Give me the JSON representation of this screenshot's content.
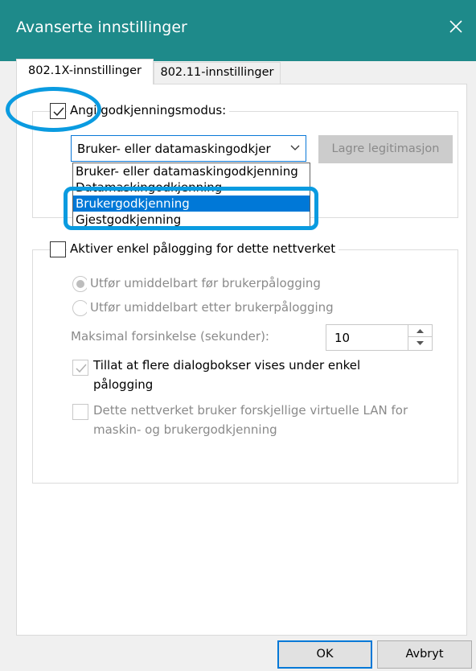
{
  "window": {
    "title": "Avanserte innstillinger",
    "close_icon": "close-icon",
    "titlebar_color": "#1e8a8a"
  },
  "tabs": [
    {
      "label": "802.1X-innstillinger",
      "active": true
    },
    {
      "label": "802.11-innstillinger",
      "active": false
    }
  ],
  "auth_mode": {
    "checkbox_label": "Angi godkjenningsmodus:",
    "checked": true,
    "combo_value": "Bruker- eller datamaskingodkjer",
    "options": [
      "Bruker- eller datamaskingodkjenning",
      "Datamaskingodkjenning",
      "Brukergodkjenning",
      "Gjestgodkjenning"
    ],
    "selected_index": 2,
    "save_button_label": "Lagre legitimasjon"
  },
  "sso": {
    "checkbox_label": "Aktiver enkel pålogging for dette nettverket",
    "checked": false,
    "radio_before": "Utfør umiddelbart før brukerpålogging",
    "radio_after": "Utfør umiddelbart etter brukerpålogging",
    "max_delay_label": "Maksimal forsinkelse (sekunder):",
    "max_delay_value": "10",
    "allow_dialogs_line1": "Tillat at flere dialogbokser vises under enkel",
    "allow_dialogs_line2": "pålogging",
    "allow_dialogs_checked": true,
    "vlan_line1": "Dette nettverket bruker forskjellige virtuelle LAN for",
    "vlan_line2": "maskin- og brukergodkjenning",
    "vlan_checked": false
  },
  "footer": {
    "ok_label": "OK",
    "cancel_label": "Avbryt"
  },
  "colors": {
    "accent": "#0078d7",
    "annotation": "#0a9be0"
  }
}
